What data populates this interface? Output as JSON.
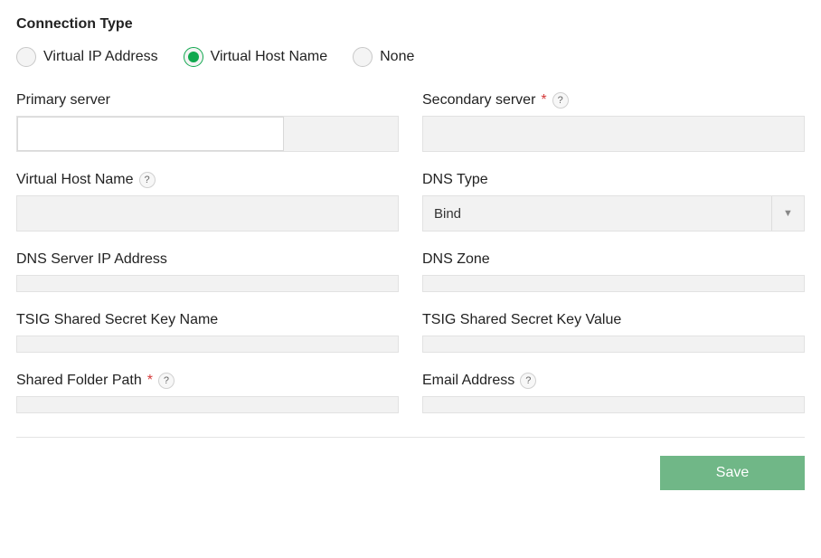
{
  "section_title": "Connection Type",
  "radios": {
    "virtual_ip": "Virtual IP Address",
    "virtual_host": "Virtual Host Name",
    "none": "None",
    "selected": "virtual_host"
  },
  "fields": {
    "primary_server": {
      "label": "Primary server",
      "value": ""
    },
    "secondary_server": {
      "label": "Secondary server",
      "required": "*",
      "value": ""
    },
    "virtual_host_name": {
      "label": "Virtual Host Name",
      "value": ""
    },
    "dns_type": {
      "label": "DNS Type",
      "selected": "Bind"
    },
    "dns_server_ip": {
      "label": "DNS Server IP Address",
      "value": ""
    },
    "dns_zone": {
      "label": "DNS Zone",
      "value": ""
    },
    "tsig_key_name": {
      "label": "TSIG Shared Secret Key Name",
      "value": ""
    },
    "tsig_key_value": {
      "label": "TSIG Shared Secret Key Value",
      "value": ""
    },
    "shared_folder_path": {
      "label": "Shared Folder Path",
      "required": "*",
      "value": ""
    },
    "email_address": {
      "label": "Email Address",
      "value": ""
    }
  },
  "help_glyph": "?",
  "buttons": {
    "save": "Save"
  }
}
